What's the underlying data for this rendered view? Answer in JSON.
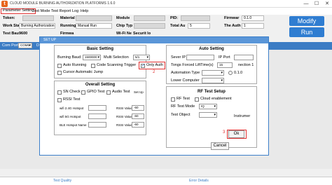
{
  "app": {
    "icon": "t",
    "title": "CLOUD MODULE BURNING AUTHORIZATION PLATFORMS 1.6.0",
    "minimize": "—",
    "maximize": "☐",
    "close": "✕"
  },
  "menu": [
    "Parameter Setting",
    "Test Mode",
    "Test Report",
    "Log",
    "Help"
  ],
  "main": {
    "token_label": "Token:",
    "work_station_label": "Work Sta",
    "work_station_value": "Burning Authorization",
    "test_baud_label": "Test Bau",
    "test_baud_value": "9600",
    "material_label": "Material",
    "running_label": "Running",
    "running_value": "Manual Run",
    "firmware_label": "Firmwa",
    "module_label": "Module",
    "chip_type_label": "Chip Typ",
    "wifi_label": "Wi-Fi Ne",
    "wifi_value": "Securit lo",
    "pid_label": "PID:",
    "total_auth_label": "Total Au",
    "total_auth_value": "5",
    "firmware_right_label": "Firmwar",
    "firmware_right_value": "0.1.0",
    "auth_label": "The Auth",
    "auth_value": "1",
    "modify_button": "Modify",
    "run_button": "Run"
  },
  "port": {
    "com_port_label": "Com Port",
    "com_port_value": "COM5",
    "extra_label": "D5"
  },
  "dialog": {
    "title": "SET UP",
    "basic": {
      "heading": "Basic Setting",
      "burning_baud_label": "Burning Baud",
      "burning_baud_value": "1500000",
      "multi_selection_label": "Multi Selection",
      "multi_selection_value": "5/1",
      "auto_running_label": "Auto Running",
      "code_scanning_label": "Code Scanning Trigger",
      "only_auth_label": "Only Auth",
      "cursor_label": "Cursor Automatic Jump",
      "only_auth_marker": "2"
    },
    "overall": {
      "heading": "Overall Setting",
      "sn_check_label": "SN Check",
      "gpio_test_label": "GPIO Test",
      "audio_test_label": "Audio Test",
      "setup_link": "Set Up",
      "rssi_test_label": "RSSI Test",
      "wifi_24_label": "wifi 2.4G Hotspot",
      "wifi_24_rssi_label": "RSSI Value",
      "wifi_24_rssi_value": "-60",
      "wifi_5_label": "wifi 5G Hotspot",
      "wifi_5_rssi_label": "RSSI Value",
      "wifi_5_rssi_value": "-60",
      "ble_label": "BLE Hotspot Name",
      "ble_rssi_label": "RSSI Value",
      "ble_rssi_value": "-60"
    },
    "auto": {
      "heading": "Auto Setting",
      "server_ip_label": "Sever IP",
      "ip_port_label": "IP Port",
      "tongs_label": "Tongs Forced LiftTime(s)",
      "tongs_value": "15",
      "connection_label": "nection 1",
      "automation_type_label": "Automation Type",
      "radio_label": "0.1.0",
      "lower_computer_label": "Lower Computer"
    },
    "rf": {
      "heading": "RF Test Setup",
      "rf_test_label": "RF Test",
      "cloud_label": "Cloud enablement",
      "rf_test_mode_label": "RF Test Mode",
      "rf_test_mode_value": "IQ",
      "test_object_label": "Test Object",
      "instrument_label": "Instrumer"
    },
    "ok_button": "Ok",
    "cancel_button": "Cancel",
    "ok_marker": "3"
  },
  "status": {
    "left": "Test Quality",
    "right": "Error Details"
  },
  "colors": {
    "accent": "#3b7cc4",
    "button": "#2f7dd1",
    "highlight": "#e03030",
    "app_icon": "#e8651d"
  }
}
